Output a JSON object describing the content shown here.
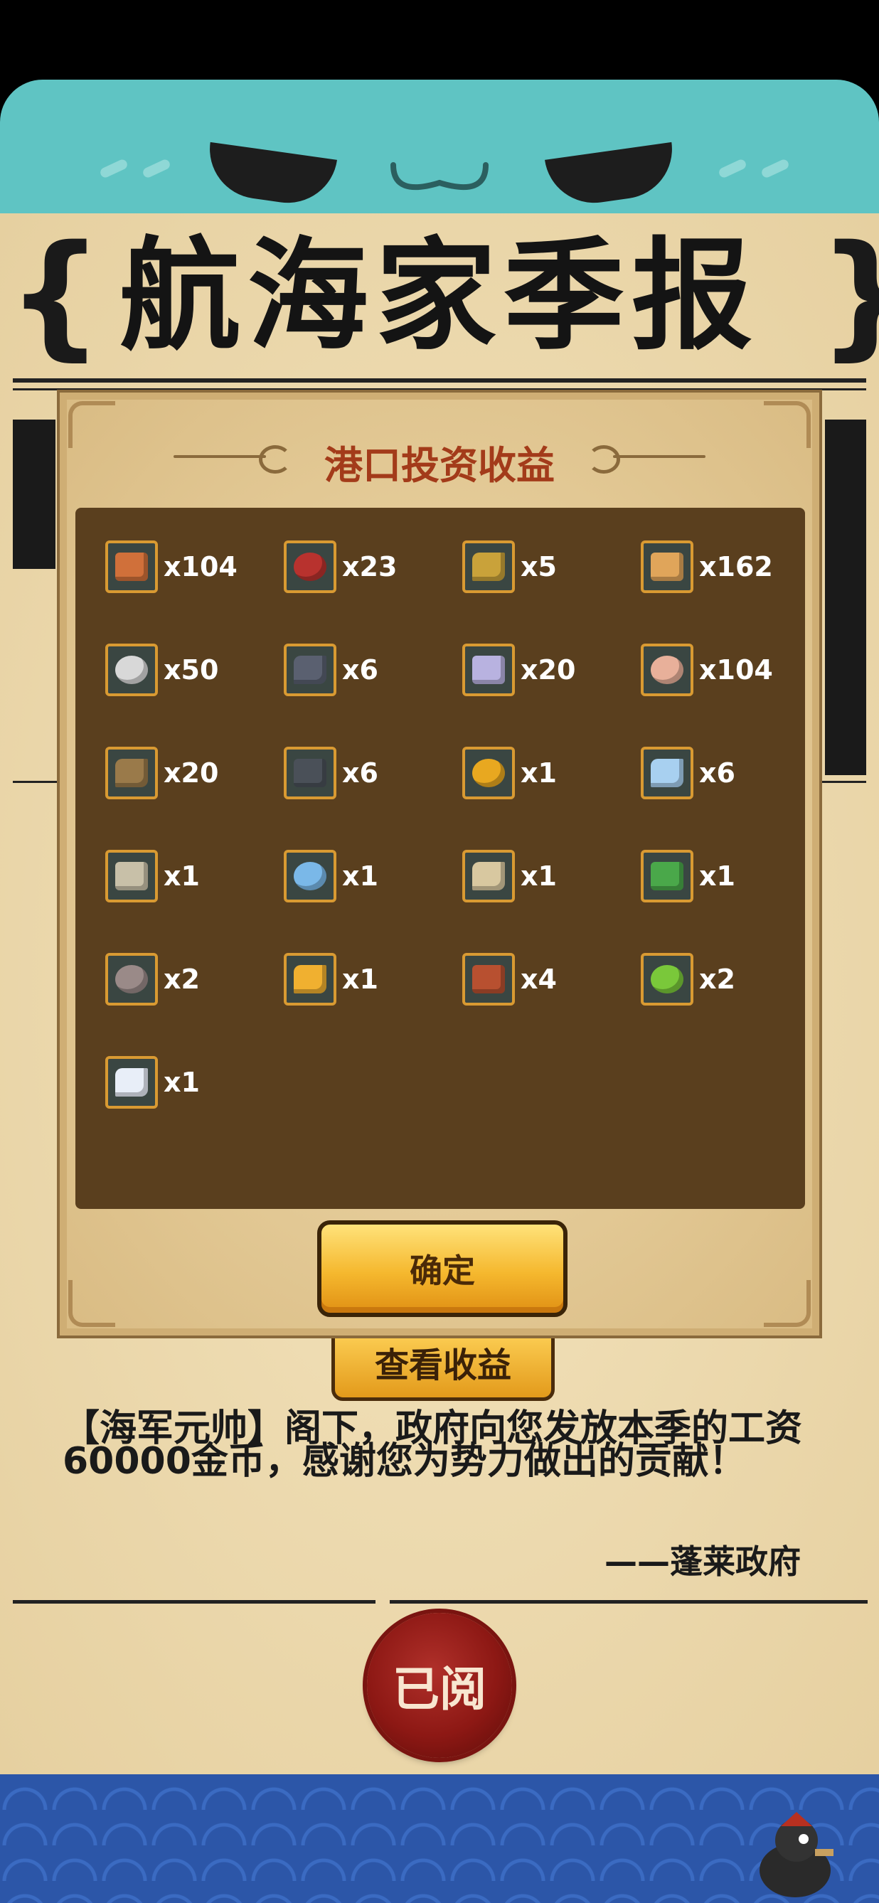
{
  "newspaper": {
    "title": "航海家季报",
    "view_button_label": "查看收益",
    "headline": "【海军元帅】阁下，政府向您发放本季的工资60000金币，感谢您为势力做出的贡献！",
    "signature": "——蓬莱政府",
    "read_seal_label": "已阅"
  },
  "modal": {
    "title": "港口投资收益",
    "confirm_label": "确定",
    "items": [
      {
        "icon": "wood-planks-icon",
        "count": "x104",
        "color": "#d0703a"
      },
      {
        "icon": "red-planks-icon",
        "count": "x23",
        "color": "#b8322e"
      },
      {
        "icon": "gold-plate-icon",
        "count": "x5",
        "color": "#c9a23a"
      },
      {
        "icon": "lumber-icon",
        "count": "x162",
        "color": "#e0a55a"
      },
      {
        "icon": "fish-bone-icon",
        "count": "x50",
        "color": "#d8d8d8"
      },
      {
        "icon": "iron-plate-icon",
        "count": "x6",
        "color": "#5a6070"
      },
      {
        "icon": "purple-stone-icon",
        "count": "x20",
        "color": "#b8b2e0"
      },
      {
        "icon": "pink-stone-icon",
        "count": "x104",
        "color": "#e8b09a"
      },
      {
        "icon": "rope-coil-icon",
        "count": "x20",
        "color": "#9a7a4a"
      },
      {
        "icon": "iron-spike-icon",
        "count": "x6",
        "color": "#4a5058"
      },
      {
        "icon": "gold-hexagon-icon",
        "count": "x1",
        "color": "#e8a820"
      },
      {
        "icon": "blue-crystal-icon",
        "count": "x6",
        "color": "#a8d0f0"
      },
      {
        "icon": "bone-claw-icon",
        "count": "x1",
        "color": "#c8c0a8"
      },
      {
        "icon": "water-drop-icon",
        "count": "x1",
        "color": "#7ab8e8"
      },
      {
        "icon": "feather-icon",
        "count": "x1",
        "color": "#d8c8a0"
      },
      {
        "icon": "green-gem-icon",
        "count": "x1",
        "color": "#4aa84a"
      },
      {
        "icon": "cloth-stack-icon",
        "count": "x2",
        "color": "#9a8a88"
      },
      {
        "icon": "amber-stone-icon",
        "count": "x1",
        "color": "#f0b030"
      },
      {
        "icon": "red-hammer-icon",
        "count": "x4",
        "color": "#b85030"
      },
      {
        "icon": "green-potion-icon",
        "count": "x2",
        "color": "#7ac83a"
      },
      {
        "icon": "pearl-icon",
        "count": "x1",
        "color": "#e8eef8"
      }
    ]
  }
}
